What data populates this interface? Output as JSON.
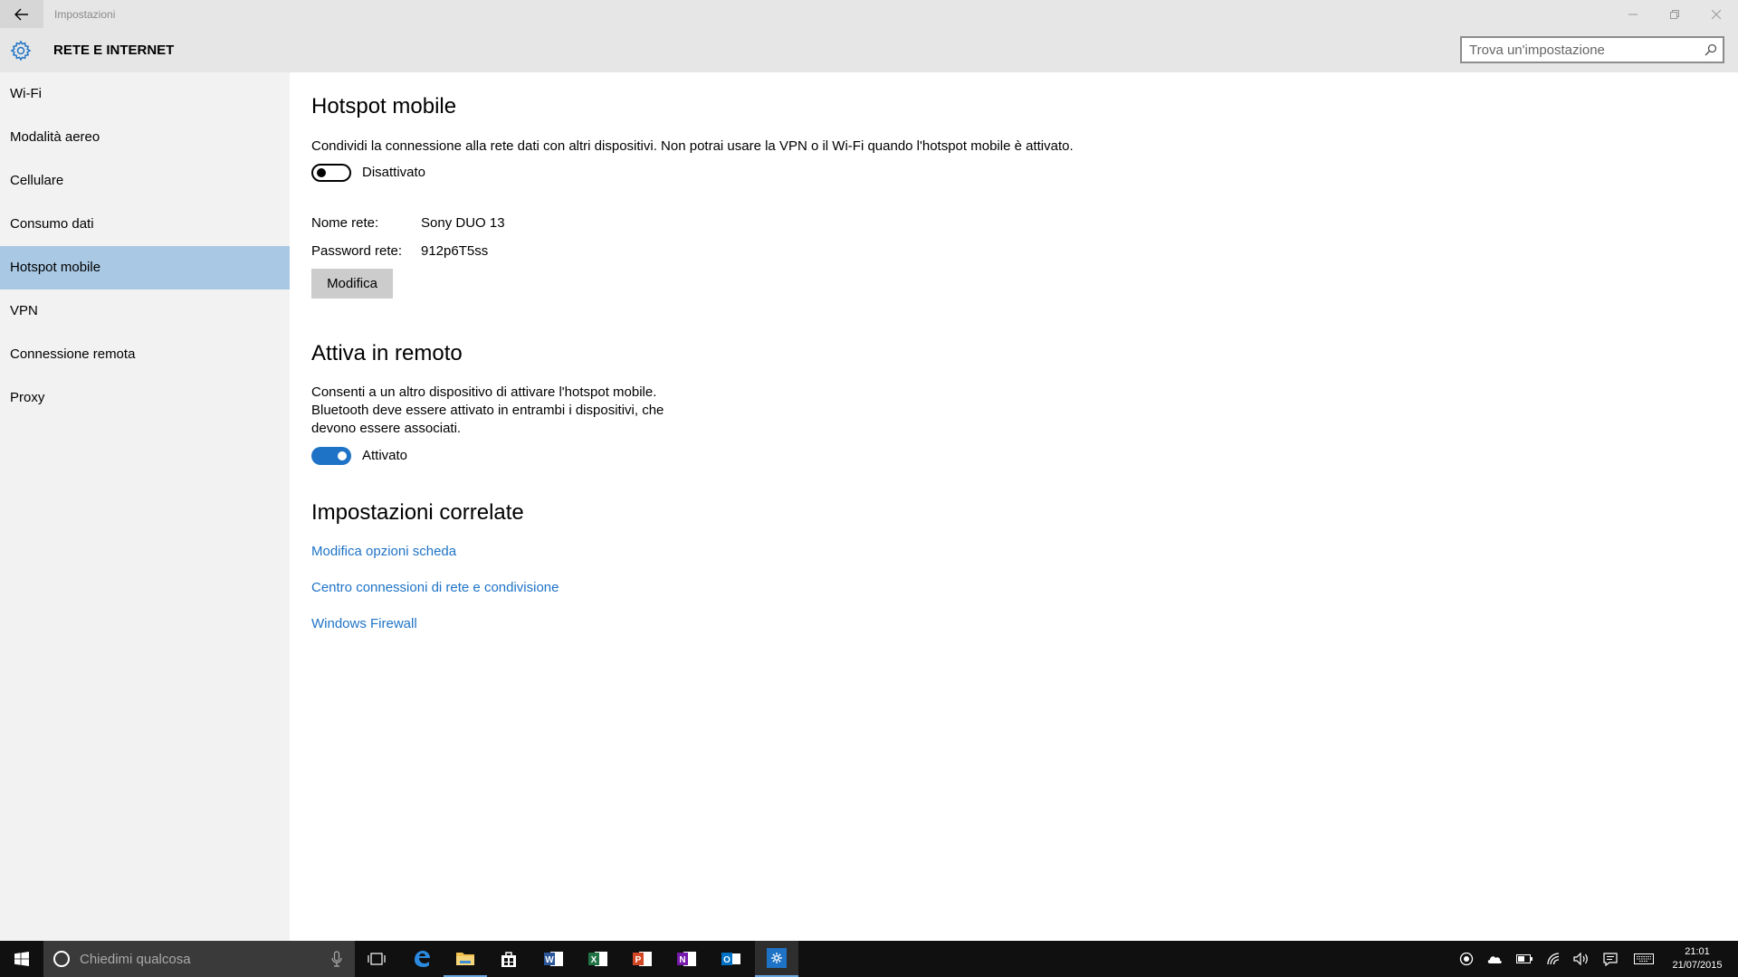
{
  "window": {
    "title": "Impostazioni"
  },
  "header": {
    "title": "RETE E INTERNET",
    "search_placeholder": "Trova un'impostazione"
  },
  "sidebar": {
    "items": [
      {
        "label": "Wi-Fi"
      },
      {
        "label": "Modalità aereo"
      },
      {
        "label": "Cellulare"
      },
      {
        "label": "Consumo dati"
      },
      {
        "label": "Hotspot mobile",
        "selected": true
      },
      {
        "label": "VPN"
      },
      {
        "label": "Connessione remota"
      },
      {
        "label": "Proxy"
      }
    ]
  },
  "main": {
    "hotspot": {
      "title": "Hotspot mobile",
      "description": "Condividi la connessione alla rete dati con altri dispositivi. Non potrai usare la VPN o il Wi-Fi quando l'hotspot mobile è attivato.",
      "toggle_label": "Disattivato",
      "toggle_state": "off",
      "network_name_label": "Nome rete:",
      "network_name": "Sony DUO 13",
      "password_label": "Password rete:",
      "password": "912p6T5ss",
      "edit_button": "Modifica"
    },
    "remote": {
      "title": "Attiva in remoto",
      "description_lines": [
        "Consenti a un altro dispositivo di attivare l'hotspot mobile.",
        "Bluetooth deve essere attivato in entrambi i dispositivi, che",
        "devono essere associati."
      ],
      "toggle_label": "Attivato",
      "toggle_state": "on"
    },
    "related": {
      "title": "Impostazioni correlate",
      "links": [
        "Modifica opzioni scheda",
        "Centro connessioni di rete e condivisione",
        "Windows Firewall"
      ]
    }
  },
  "taskbar": {
    "search_placeholder": "Chiedimi qualcosa",
    "apps": [
      "task-view",
      "edge",
      "file-explorer",
      "store",
      "word",
      "excel",
      "powerpoint",
      "onenote",
      "outlook",
      "settings"
    ],
    "clock": {
      "time": "21:01",
      "date": "21/07/2015"
    }
  },
  "colors": {
    "accent": "#1e73c6",
    "selected_bg": "#a8c8e4",
    "sidebar_bg": "#f2f2f2",
    "titlebar_bg": "#e6e6e6"
  }
}
